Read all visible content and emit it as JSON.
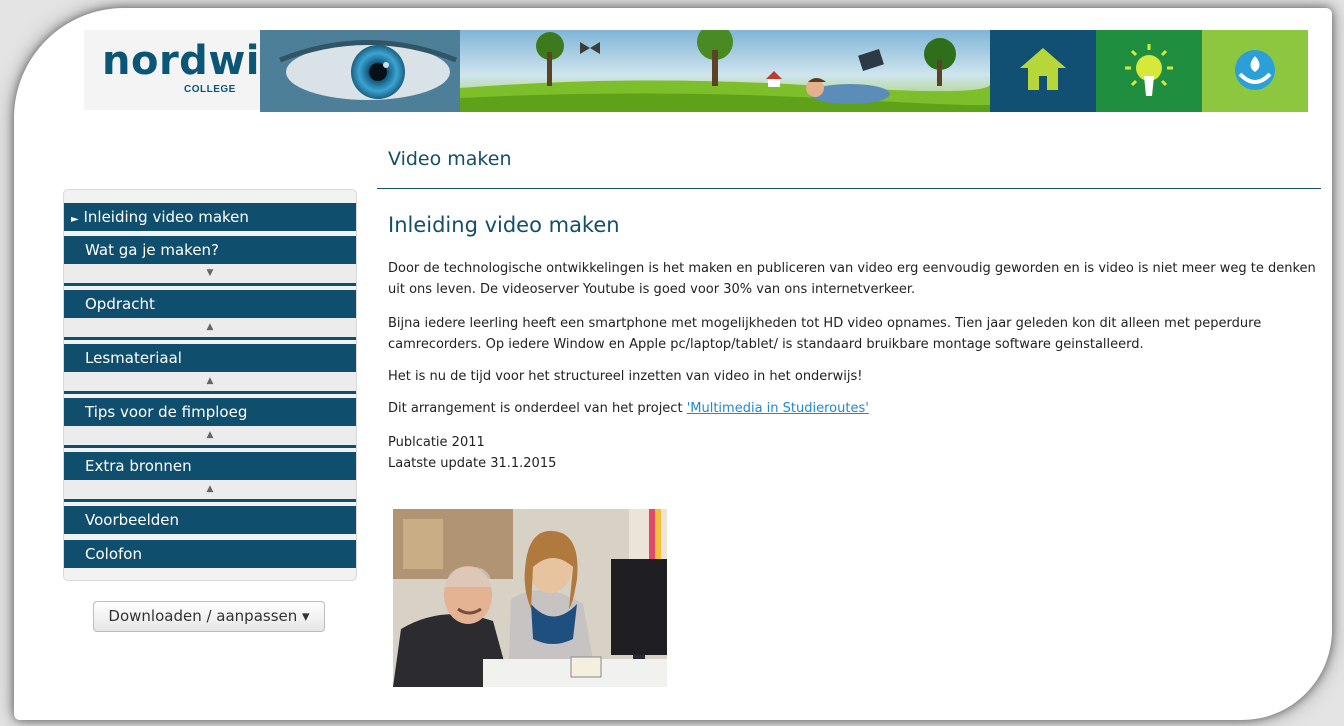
{
  "header": {
    "logo_word": "nordwin",
    "logo_sub": "COLLEGE"
  },
  "page_title": "Video maken",
  "sidebar": {
    "items": [
      {
        "label": "Inleiding video maken",
        "active": true
      },
      {
        "label": "Wat ga je maken?",
        "toggle": "▼"
      },
      {
        "label": "Opdracht",
        "toggle": "▲"
      },
      {
        "label": "Lesmateriaal",
        "toggle": "▲"
      },
      {
        "label": "Tips voor de fimploeg",
        "toggle": "▲"
      },
      {
        "label": "Extra bronnen",
        "toggle": "▲"
      },
      {
        "label": "Voorbeelden"
      },
      {
        "label": "Colofon"
      }
    ],
    "active_marker": "►",
    "download_label": "Downloaden / aanpassen",
    "download_caret": "▾"
  },
  "content": {
    "section_title": "Inleiding video maken",
    "paragraphs": [
      "Door de technologische ontwikkelingen is het maken en publiceren van video erg eenvoudig geworden en is video is niet meer weg te denken uit ons leven. De videoserver Youtube is goed voor 30% van ons internetverkeer.",
      "Bijna iedere leerling heeft een smartphone met mogelijkheden tot HD video opnames. Tien jaar geleden kon dit alleen met peperdure camrecorders. Op iedere Window en Apple pc/laptop/tablet/ is standaard bruikbare montage software geinstalleerd.",
      "Het is nu de tijd voor het structureel inzetten van video in het onderwijs!"
    ],
    "project_text": "Dit arrangement is onderdeel van het project ",
    "project_link": "'Multimedia in Studieroutes'",
    "publication": "Publcatie 2011",
    "last_update": "Laatste update 31.1.2015"
  },
  "colors": {
    "nav_bg": "#104e6d",
    "title": "#134e6a",
    "link": "#1e88d2",
    "banner_green": "#1f8f3f",
    "banner_lime": "#8dc63f"
  }
}
